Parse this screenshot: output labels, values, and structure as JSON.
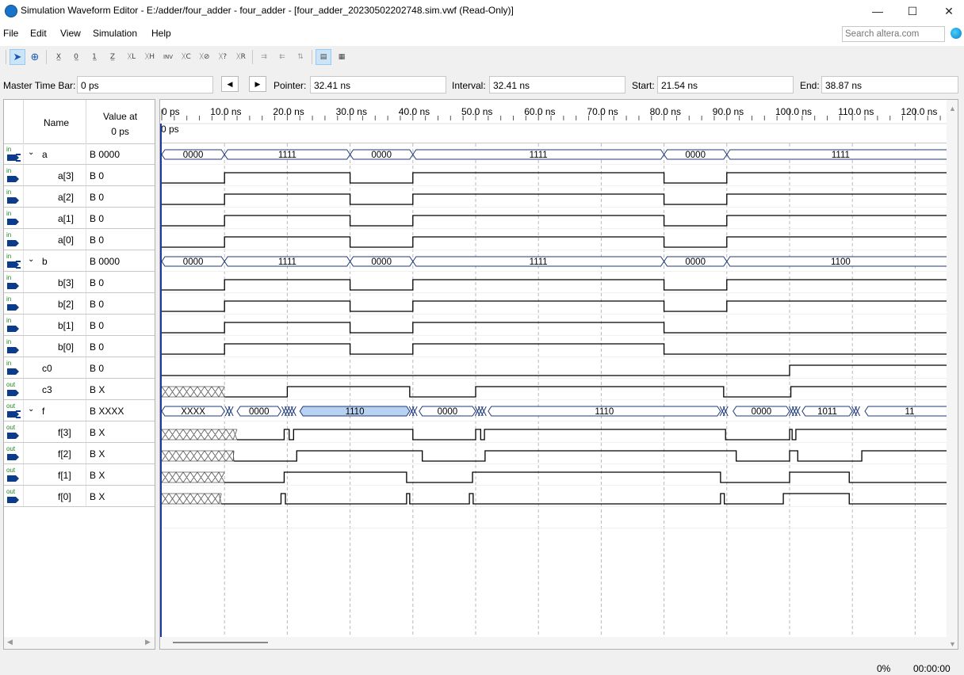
{
  "window": {
    "title": "Simulation Waveform Editor - E:/adder/four_adder - four_adder - [four_adder_20230502202748.sim.vwf (Read-Only)]",
    "minimize": "—",
    "maximize": "☐",
    "close": "✕"
  },
  "menu": [
    "File",
    "Edit",
    "View",
    "Simulation",
    "Help"
  ],
  "search": {
    "placeholder": "Search altera.com"
  },
  "toolbar_icons": [
    "selection-pointer-icon",
    "zoom-icon",
    "forcing-unknown-icon",
    "forcing-low-icon",
    "forcing-high-icon",
    "high-impedance-icon",
    "weak-low-icon",
    "weak-high-icon",
    "invert-icon",
    "count-value-icon",
    "clock-icon",
    "random-value-icon",
    "overwrite-icon",
    "group-icon",
    "ungroup-icon",
    "sort-icon",
    "snap-to-grid-icon",
    "bus-display-icon"
  ],
  "fields": {
    "master_label": "Master Time Bar:",
    "master_value": "0 ps",
    "pointer_label": "Pointer:",
    "pointer_value": "32.41 ns",
    "interval_label": "Interval:",
    "interval_value": "32.41 ns",
    "start_label": "Start:",
    "start_value": "21.54 ns",
    "end_label": "End:",
    "end_value": "38.87 ns"
  },
  "columns": {
    "name": "Name",
    "value_line1": "Value at",
    "value_line2": "0 ps"
  },
  "time_axis": {
    "labels": [
      "0 ps",
      "10.0 ns",
      "20.0 ns",
      "30.0 ns",
      "40.0 ns",
      "50.0 ns",
      "60.0 ns",
      "70.0 ns",
      "80.0 ns",
      "90.0 ns",
      "100.0 ns",
      "110.0 ns",
      "120.0 ns"
    ],
    "cursor_label": "0 ps"
  },
  "signals": [
    {
      "name": "a",
      "value": "B 0000",
      "dir": "in",
      "group": true
    },
    {
      "name": "a[3]",
      "value": "B 0",
      "dir": "in"
    },
    {
      "name": "a[2]",
      "value": "B 0",
      "dir": "in"
    },
    {
      "name": "a[1]",
      "value": "B 0",
      "dir": "in"
    },
    {
      "name": "a[0]",
      "value": "B 0",
      "dir": "in"
    },
    {
      "name": "b",
      "value": "B 0000",
      "dir": "in",
      "group": true
    },
    {
      "name": "b[3]",
      "value": "B 0",
      "dir": "in"
    },
    {
      "name": "b[2]",
      "value": "B 0",
      "dir": "in"
    },
    {
      "name": "b[1]",
      "value": "B 0",
      "dir": "in"
    },
    {
      "name": "b[0]",
      "value": "B 0",
      "dir": "in"
    },
    {
      "name": "c0",
      "value": "B 0",
      "dir": "in"
    },
    {
      "name": "c3",
      "value": "B X",
      "dir": "out"
    },
    {
      "name": "f",
      "value": "B XXXX",
      "dir": "out",
      "group": true
    },
    {
      "name": "f[3]",
      "value": "B X",
      "dir": "out"
    },
    {
      "name": "f[2]",
      "value": "B X",
      "dir": "out"
    },
    {
      "name": "f[1]",
      "value": "B X",
      "dir": "out"
    },
    {
      "name": "f[0]",
      "value": "B X",
      "dir": "out"
    }
  ],
  "bus_labels": {
    "a": [
      "0000",
      "1111",
      "0000",
      "1111",
      "0000",
      "1111"
    ],
    "b": [
      "0000",
      "1111",
      "0000",
      "1111",
      "0000",
      "1100"
    ],
    "f": [
      "XXXX",
      "0000",
      "1110",
      "0000",
      "1110",
      "0000",
      "1011",
      "11"
    ]
  },
  "status": {
    "percent": "0%",
    "elapsed": "00:00:00"
  },
  "colors": {
    "bus_stroke": "#1f3a7a",
    "highlight": "#b8d3f2",
    "cursor": "#1f3a9e"
  }
}
